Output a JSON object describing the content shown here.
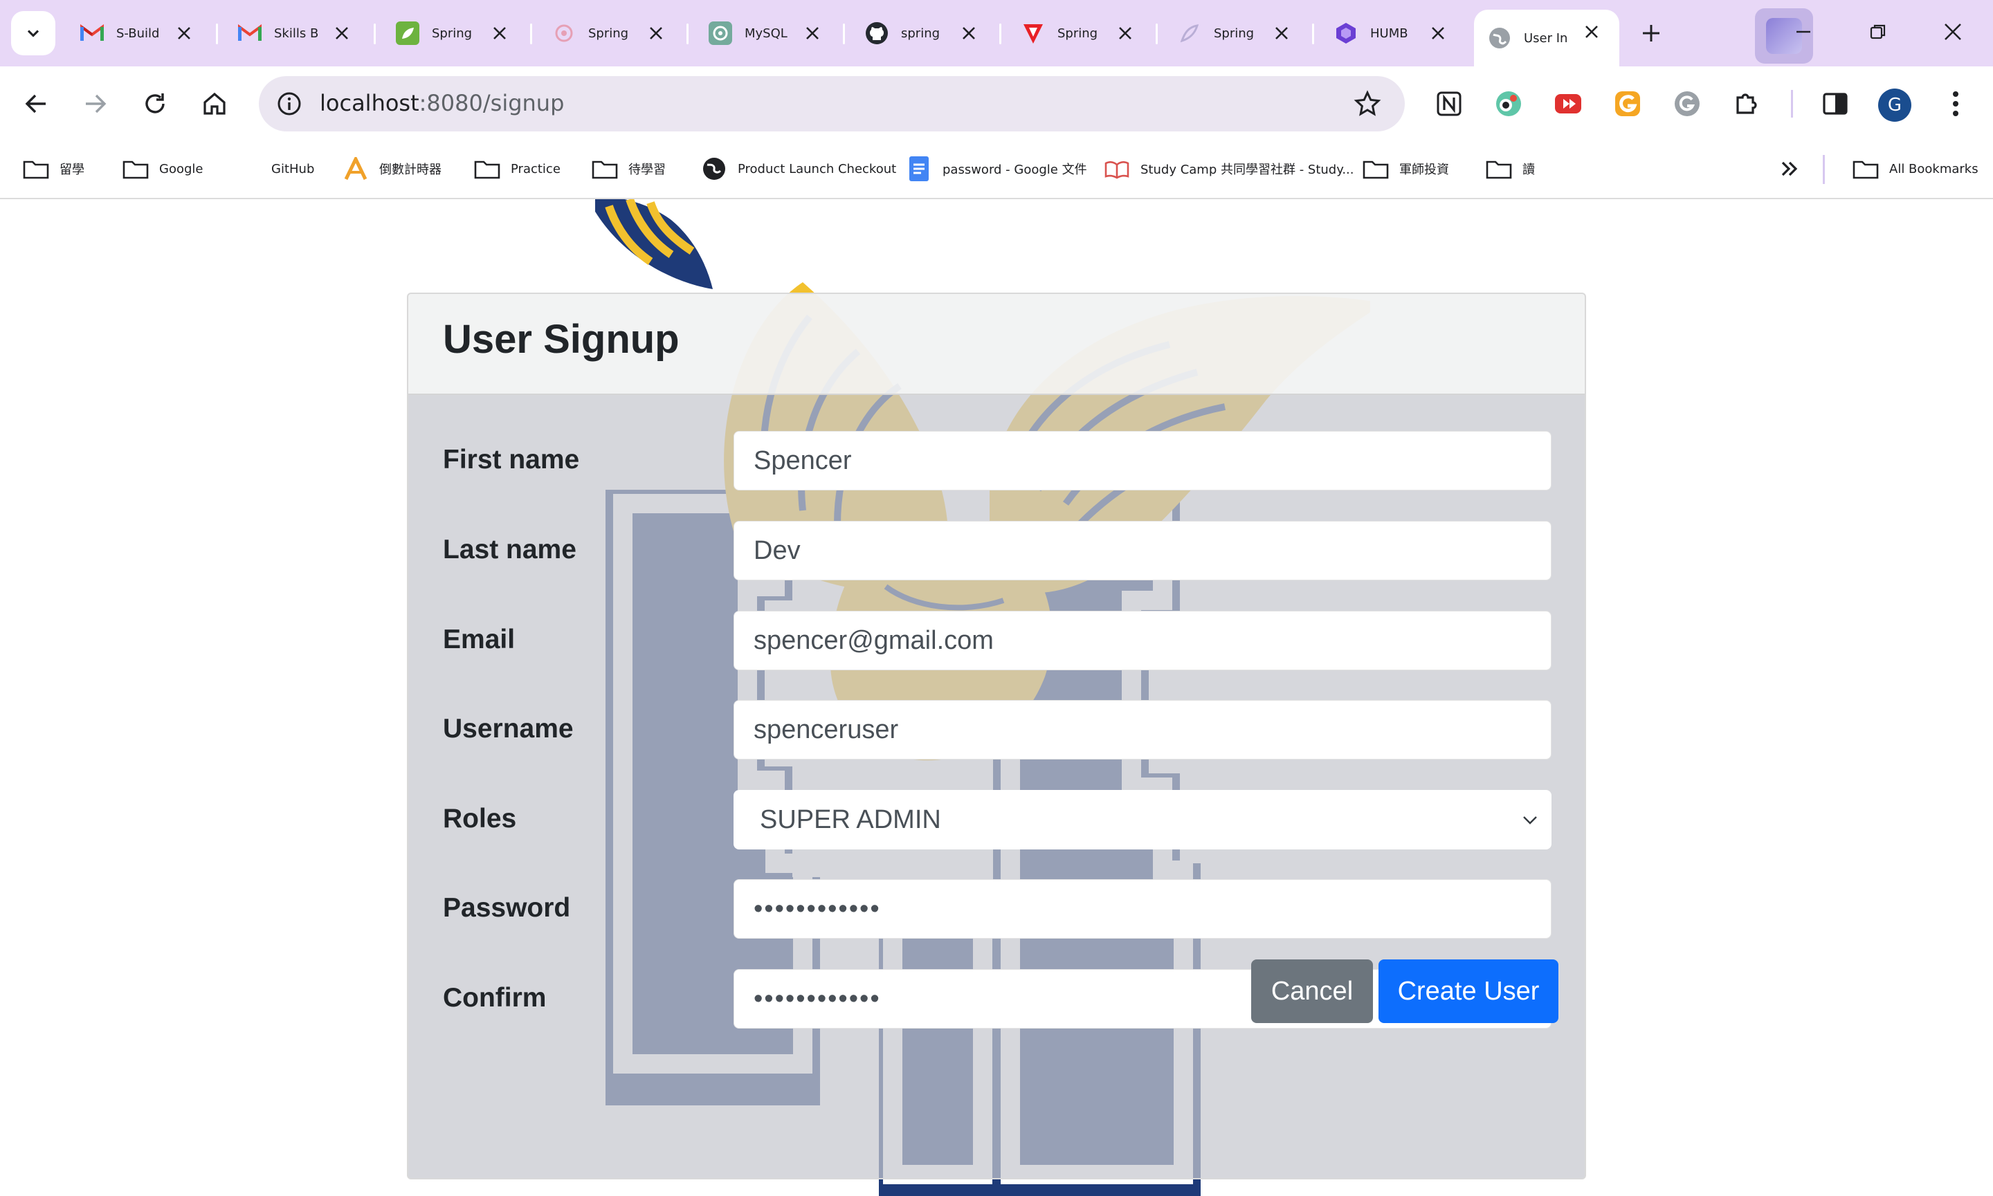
{
  "browser": {
    "tabs": [
      {
        "title": "S-Build",
        "icon": "gmail-icon"
      },
      {
        "title": "Skills B",
        "icon": "gmail-icon"
      },
      {
        "title": "Spring",
        "icon": "spring-icon"
      },
      {
        "title": "Spring",
        "icon": "spring-doc-icon"
      },
      {
        "title": "MySQL",
        "icon": "chatgpt-icon"
      },
      {
        "title": "spring",
        "icon": "github-icon"
      },
      {
        "title": "Spring",
        "icon": "tesla-icon"
      },
      {
        "title": "Spring",
        "icon": "spring-doc-icon"
      },
      {
        "title": "HUMB",
        "icon": "humbl-icon"
      },
      {
        "title": "User In",
        "icon": "globe-icon",
        "active": true
      }
    ],
    "address_host": "localhost",
    "address_path": ":8080/signup",
    "avatar_letter": "G"
  },
  "bookmarks": [
    {
      "label": "留學",
      "icon": "folder-icon"
    },
    {
      "label": "Google",
      "icon": "folder-icon"
    },
    {
      "label": "GitHub",
      "icon": "none"
    },
    {
      "label": "倒數計時器",
      "icon": "timer-icon"
    },
    {
      "label": "Practice",
      "icon": "folder-icon"
    },
    {
      "label": "待學習",
      "icon": "folder-icon"
    },
    {
      "label": "Product Launch Checkout",
      "icon": "web-icon"
    },
    {
      "label": "password - Google 文件",
      "icon": "docs-icon"
    },
    {
      "label": "Study Camp 共同學習社群 - Study...",
      "icon": "book-icon"
    },
    {
      "label": "軍師投資",
      "icon": "folder-icon"
    },
    {
      "label": "讀",
      "icon": "folder-icon"
    },
    {
      "label": "All Bookmarks",
      "icon": "folder-icon"
    }
  ],
  "form": {
    "title": "User Signup",
    "first_name_label": "First name",
    "first_name_value": "Spencer",
    "last_name_label": "Last name",
    "last_name_value": "Dev",
    "email_label": "Email",
    "email_value": "spencer@gmail.com",
    "username_label": "Username",
    "username_value": "spenceruser",
    "roles_label": "Roles",
    "roles_value": "SUPER ADMIN",
    "password_label": "Password",
    "password_value": "••••••••••••",
    "confirm_label": "Confirm",
    "confirm_value": "••••••••••••",
    "cancel_label": "Cancel",
    "create_label": "Create User"
  },
  "colors": {
    "tabstrip": "#e8d8f7",
    "primary": "#0d6efd",
    "secondary": "#6c757d",
    "mascot_blue": "#1e3a78",
    "mascot_gold": "#f2c12e"
  }
}
